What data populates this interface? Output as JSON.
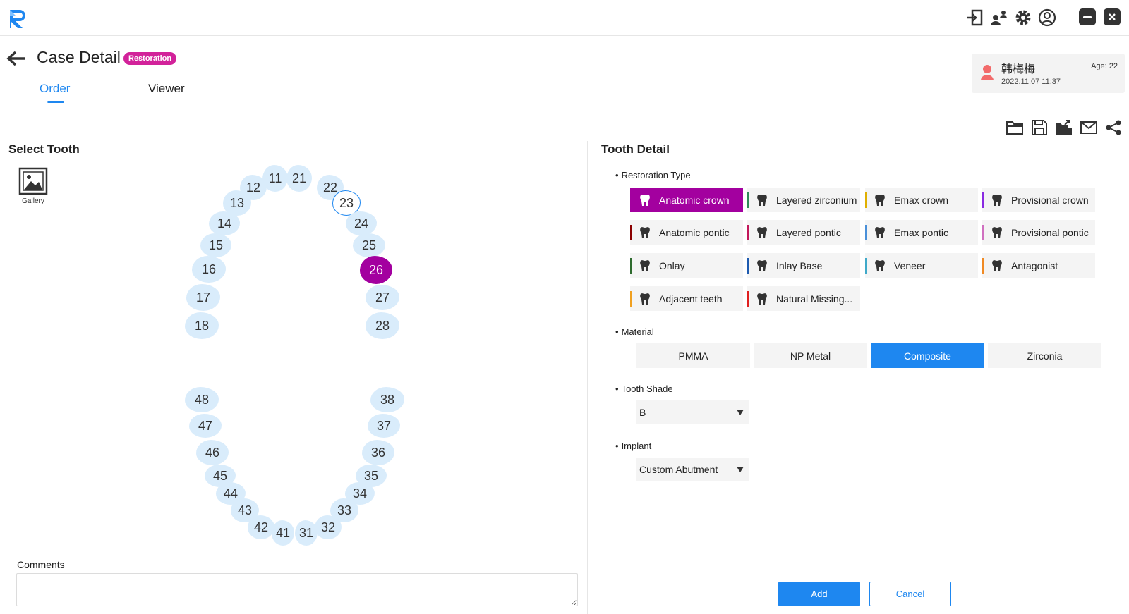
{
  "app": {
    "logo_icon": "r-logo-icon"
  },
  "topbar": {
    "icons": [
      "import-icon",
      "users-icon",
      "gear-icon",
      "account-icon"
    ],
    "minimize_icon": "minimize-icon",
    "close_icon": "close-icon"
  },
  "header": {
    "title": "Case Detail",
    "badge": "Restoration",
    "badge_color": "#d2229a",
    "tabs": [
      {
        "label": "Order",
        "active": true
      },
      {
        "label": "Viewer",
        "active": false
      }
    ]
  },
  "patient": {
    "name": "韩梅梅",
    "date": "2022.11.07 11:37",
    "age": "Age: 22"
  },
  "toolbar_icons": [
    "folder-icon",
    "save-icon",
    "export-icon",
    "mail-icon",
    "share-icon"
  ],
  "left_panel": {
    "title": "Select Tooth",
    "gallery_label": "Gallery",
    "comments_label": "Comments",
    "comments_value": "",
    "teeth": [
      {
        "n": "11",
        "state": "normal"
      },
      {
        "n": "21",
        "state": "normal"
      },
      {
        "n": "12",
        "state": "normal"
      },
      {
        "n": "22",
        "state": "normal"
      },
      {
        "n": "13",
        "state": "normal"
      },
      {
        "n": "23",
        "state": "outlined"
      },
      {
        "n": "14",
        "state": "normal"
      },
      {
        "n": "24",
        "state": "normal"
      },
      {
        "n": "15",
        "state": "normal"
      },
      {
        "n": "25",
        "state": "normal"
      },
      {
        "n": "16",
        "state": "normal"
      },
      {
        "n": "26",
        "state": "selected"
      },
      {
        "n": "17",
        "state": "normal"
      },
      {
        "n": "27",
        "state": "normal"
      },
      {
        "n": "18",
        "state": "normal"
      },
      {
        "n": "28",
        "state": "normal"
      },
      {
        "n": "48",
        "state": "normal"
      },
      {
        "n": "38",
        "state": "normal"
      },
      {
        "n": "47",
        "state": "normal"
      },
      {
        "n": "37",
        "state": "normal"
      },
      {
        "n": "46",
        "state": "normal"
      },
      {
        "n": "36",
        "state": "normal"
      },
      {
        "n": "45",
        "state": "normal"
      },
      {
        "n": "35",
        "state": "normal"
      },
      {
        "n": "44",
        "state": "normal"
      },
      {
        "n": "34",
        "state": "normal"
      },
      {
        "n": "43",
        "state": "normal"
      },
      {
        "n": "33",
        "state": "normal"
      },
      {
        "n": "42",
        "state": "normal"
      },
      {
        "n": "32",
        "state": "normal"
      },
      {
        "n": "41",
        "state": "normal"
      },
      {
        "n": "31",
        "state": "normal"
      }
    ],
    "selected_color": "#a3009f",
    "tooth_color": "#d9ecfb"
  },
  "right_panel": {
    "title": "Tooth Detail",
    "restoration_label": "Restoration Type",
    "restoration_types": [
      {
        "label": "Anatomic crown",
        "color": "#a3009f",
        "icon": "crown-icon",
        "active": true
      },
      {
        "label": "Layered zirconium",
        "color": "#2e8b57",
        "icon": "zirconium-icon",
        "active": false
      },
      {
        "label": "Emax crown",
        "color": "#e0b000",
        "icon": "emax-crown-icon",
        "active": false
      },
      {
        "label": "Provisional crown",
        "color": "#8a2be2",
        "icon": "provisional-crown-icon",
        "active": false
      },
      {
        "label": "Anatomic pontic",
        "color": "#8b0000",
        "icon": "pontic-icon",
        "active": false
      },
      {
        "label": "Layered pontic",
        "color": "#c2185b",
        "icon": "layered-pontic-icon",
        "active": false
      },
      {
        "label": "Emax pontic",
        "color": "#4a90d9",
        "icon": "emax-pontic-icon",
        "active": false
      },
      {
        "label": "Provisional pontic",
        "color": "#d070c0",
        "icon": "provisional-pontic-icon",
        "active": false
      },
      {
        "label": "Onlay",
        "color": "#2e6b2e",
        "icon": "onlay-icon",
        "active": false
      },
      {
        "label": "Inlay Base",
        "color": "#1e5bb0",
        "icon": "inlay-icon",
        "active": false
      },
      {
        "label": "Veneer",
        "color": "#3fa9c9",
        "icon": "veneer-icon",
        "active": false
      },
      {
        "label": "Antagonist",
        "color": "#f08a24",
        "icon": "antagonist-icon",
        "active": false
      },
      {
        "label": "Adjacent teeth",
        "color": "#f0a020",
        "icon": "adjacent-teeth-icon",
        "active": false
      },
      {
        "label": "Natural Missing...",
        "color": "#e02020",
        "icon": "missing-tooth-icon",
        "active": false
      }
    ],
    "material_label": "Material",
    "materials": [
      {
        "label": "PMMA",
        "active": false
      },
      {
        "label": "NP Metal",
        "active": false
      },
      {
        "label": "Composite",
        "active": true
      },
      {
        "label": "Zirconia",
        "active": false
      }
    ],
    "shade_label": "Tooth Shade",
    "shade_value": "B",
    "implant_label": "Implant",
    "implant_value": "Custom Abutment",
    "add_label": "Add",
    "cancel_label": "Cancel",
    "accent_color": "#1e87f0"
  }
}
